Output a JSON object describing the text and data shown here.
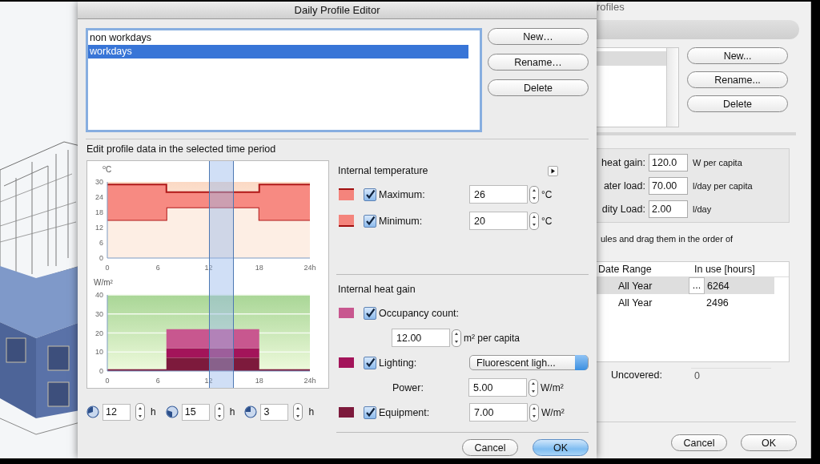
{
  "dialog": {
    "title": "Daily Profile Editor",
    "profiles": [
      {
        "label": "non workdays",
        "selected": false
      },
      {
        "label": "workdays",
        "selected": true
      }
    ],
    "buttons": [
      "New…",
      "Rename…",
      "Delete"
    ],
    "section_label": "Edit profile data in the selected time period",
    "temperature_chart": {
      "chart_data": {
        "type": "area",
        "stacked": true,
        "ylabel": "⁰C",
        "x": [
          0,
          7,
          7,
          18,
          18,
          24
        ],
        "series": [
          {
            "color": "#fdeee4",
            "values": [
              15,
              15,
              20,
              20,
              15,
              15
            ]
          },
          {
            "color": "#f78a82",
            "values": [
              14,
              14,
              6,
              6,
              14,
              14
            ]
          }
        ],
        "xlim": [
          0,
          24
        ],
        "ylim": [
          0,
          30
        ],
        "xticks": [
          0,
          6,
          12,
          18,
          {
            "value": 24,
            "label": "24h"
          }
        ],
        "yticks": [
          0,
          6,
          12,
          18,
          24,
          30
        ]
      }
    },
    "heat_chart": {
      "chart_data": {
        "type": "area",
        "stacked": true,
        "grid": true,
        "ylabel": "W/m²",
        "x": [
          0,
          7,
          7,
          18,
          18,
          24
        ],
        "series": [
          {
            "color": "#7d1a3c",
            "values": [
              1,
              1,
              7,
              7,
              1,
              1
            ]
          },
          {
            "color": "#a3145a",
            "values": [
              0,
              0,
              5,
              5,
              0,
              0
            ]
          },
          {
            "color": "#c8578f",
            "values": [
              0,
              0,
              10,
              10,
              0,
              0
            ]
          }
        ],
        "xlim": [
          0,
          24
        ],
        "ylim": [
          0,
          40
        ],
        "xticks": [
          0,
          6,
          12,
          18,
          {
            "value": 24,
            "label": "24h"
          }
        ],
        "yticks": [
          0,
          10,
          20,
          30,
          40
        ]
      }
    },
    "time_fields": [
      {
        "value": "12",
        "unit": "h"
      },
      {
        "value": "15",
        "unit": "h"
      },
      {
        "value": "3",
        "unit": "h"
      }
    ],
    "temperature": {
      "heading": "Internal temperature",
      "rows": [
        {
          "label": "Maximum:",
          "checked": true,
          "color": "#f4847c",
          "line_top": true,
          "value": "26",
          "unit": "°C"
        },
        {
          "label": "Minimum:",
          "checked": true,
          "color": "#f4847c",
          "line_top": false,
          "value": "20",
          "unit": "°C"
        }
      ]
    },
    "heat_gain": {
      "heading": "Internal heat gain",
      "rows": [
        {
          "kind": "check",
          "label": "Occupancy count:",
          "checked": true,
          "color": "#c8578f"
        },
        {
          "kind": "field",
          "value": "12.00",
          "unit": "m² per capita"
        },
        {
          "kind": "check-select",
          "label": "Lighting:",
          "checked": true,
          "color": "#a3145a",
          "value": "Fluorescent ligh..."
        },
        {
          "kind": "labeled-field",
          "label": "Power:",
          "value": "5.00",
          "unit": "W/m²"
        },
        {
          "kind": "check-field",
          "label": "Equipment:",
          "checked": true,
          "color": "#7d1a3c",
          "value": "7.00",
          "unit": "W/m²"
        }
      ]
    },
    "footer": [
      {
        "label": "Cancel",
        "default": false
      },
      {
        "label": "OK",
        "default": true
      }
    ]
  },
  "profiles_window": {
    "title": "rofiles",
    "buttons": [
      "New...",
      "Rename...",
      "Delete"
    ],
    "loads": [
      {
        "label": "heat gain:",
        "value": "120.0",
        "unit": "W per capita"
      },
      {
        "label": "ater load:",
        "value": "70.00",
        "unit": "l/day per capita"
      },
      {
        "label": "dity Load:",
        "value": "2.00",
        "unit": "l/day"
      }
    ],
    "note": "ules and drag them in the order of",
    "table": {
      "columns": [
        "Date Range",
        "In use [hours]"
      ],
      "rows": [
        {
          "cells": [
            "All Year",
            "6264"
          ],
          "selected": true,
          "action": "..."
        },
        {
          "cells": [
            "All Year",
            "2496"
          ],
          "selected": false
        }
      ]
    },
    "uncovered": {
      "label": "Uncovered:",
      "value": "0"
    },
    "footer": [
      "Cancel",
      "OK"
    ]
  }
}
